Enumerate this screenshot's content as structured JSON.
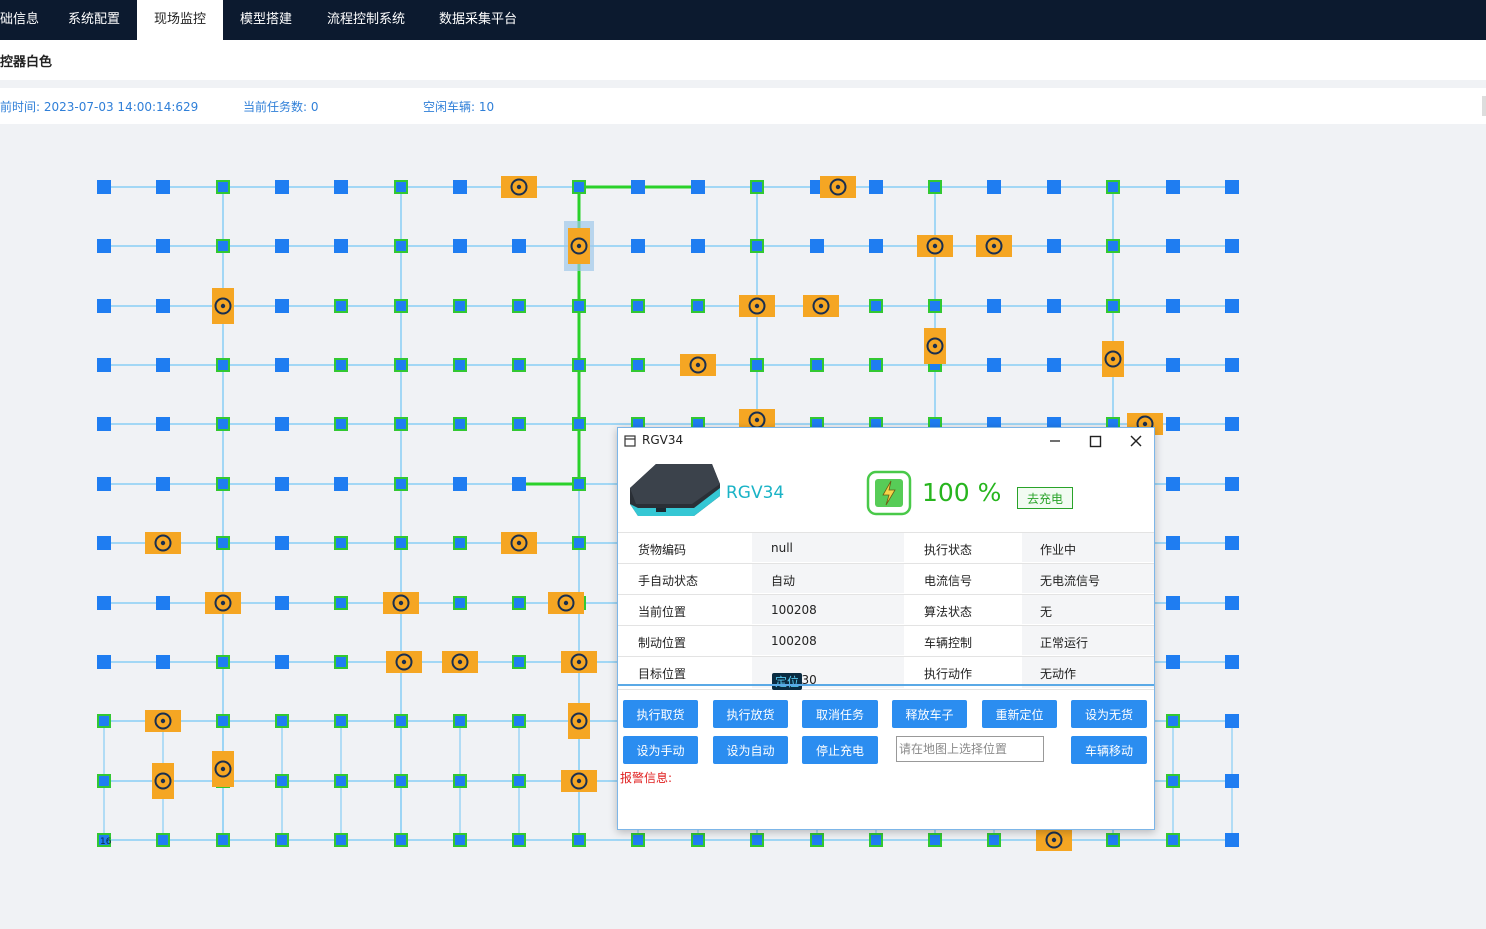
{
  "nav": {
    "items": [
      "础信息",
      "系统配置",
      "现场监控",
      "模型搭建",
      "流程控制系统",
      "数据采集平台"
    ],
    "active": "现场监控"
  },
  "page": {
    "title": "控器白色"
  },
  "status": {
    "time_label": "前时间:",
    "time_value": "2023-07-03 14:00:14:629",
    "task_label": "当前任务数:",
    "task_value": "0",
    "idle_label": "空闲车辆:",
    "idle_value": "10"
  },
  "map": {
    "colors": {
      "node": "#1f7df1",
      "node_active": "#32c832",
      "track": "#87cef5",
      "route": "#2ad12a",
      "cart": "#f5a623",
      "cart_mark": "#1a2f4f"
    },
    "route_label": "green highlighted path",
    "corner_label": "16"
  },
  "dialog": {
    "title": "RGV34",
    "vehicle_name": "RGV34",
    "battery": "100 %",
    "charge_button": "去充电",
    "rows": [
      {
        "label": "货物编码",
        "value": "null",
        "label2": "执行状态",
        "value2": "作业中"
      },
      {
        "label": "手自动状态",
        "value": "自动",
        "label2": "电流信号",
        "value2": "无电流信号"
      },
      {
        "label": "当前位置",
        "value": "100208",
        "label2": "算法状态",
        "value2": "无"
      },
      {
        "label": "制动位置",
        "value": "100208",
        "label2": "车辆控制",
        "value2": "正常运行"
      },
      {
        "label": "目标位置",
        "value": "100230",
        "label2": "执行动作",
        "value2": "无动作"
      }
    ],
    "locate_button": "定位",
    "buttons_row1": [
      "执行取货",
      "执行放货",
      "取消任务",
      "释放车子",
      "重新定位",
      "设为无货"
    ],
    "buttons_row2": [
      "设为手动",
      "设为自动",
      "停止充电"
    ],
    "position_placeholder": "请在地图上选择位置",
    "move_button": "车辆移动",
    "alarm_label": "报警信息:"
  }
}
